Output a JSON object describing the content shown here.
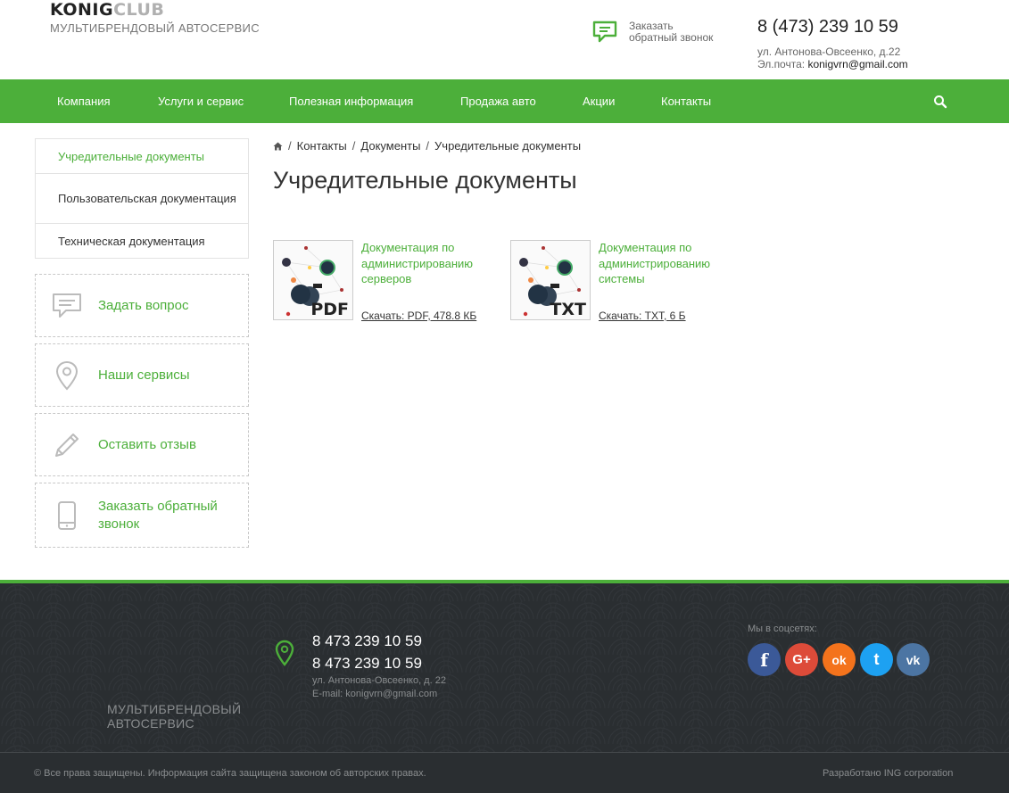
{
  "header": {
    "logo_part1": "KONIG",
    "logo_part2": "CLUB",
    "logo_subtitle": "МУЛЬТИБРЕНДОВЫЙ АВТОСЕРВИС",
    "callback_line1": "Заказать",
    "callback_line2": "обратный звонок",
    "phone": "8 (473) 239 10 59",
    "address": "ул. Антонова-Овсеенко, д.22",
    "email_label": "Эл.почта: ",
    "email": "konigvrn@gmail.com"
  },
  "nav": {
    "items": [
      "Компания",
      "Услуги и сервис",
      "Полезная информация",
      "Продажа авто",
      "Акции",
      "Контакты"
    ],
    "search_icon": "search-icon"
  },
  "sidebar": {
    "menu": [
      "Учредительные документы",
      "Пользовательская документация",
      "Техническая документация"
    ],
    "boxes": [
      {
        "label": "Задать вопрос",
        "icon": "chat-icon"
      },
      {
        "label": "Наши сервисы",
        "icon": "map-pin-icon"
      },
      {
        "label": "Оставить отзыв",
        "icon": "pencil-icon"
      },
      {
        "label": "Заказать обратный звонок",
        "icon": "smartphone-icon"
      }
    ]
  },
  "breadcrumb": {
    "home_icon": "home-icon",
    "items": [
      "Контакты",
      "Документы",
      "Учредительные документы"
    ]
  },
  "page_title": "Учредительные документы",
  "documents": [
    {
      "title": "Документация по администрированию серверов",
      "type": "PDF",
      "download": "Скачать: PDF, 478.8 КБ"
    },
    {
      "title": "Документация по администрированию системы",
      "type": "TXT",
      "download": "Скачать: TXT, 6 Б"
    }
  ],
  "footer": {
    "subtitle": "МУЛЬТИБРЕНДОВЫЙ АВТОСЕРВИС",
    "phone1": "8 473 239 10 59",
    "phone2": "8 473 239 10 59",
    "address": "ул. Антонова-Овсеенко, д. 22",
    "email": "E-mail: konigvrn@gmail.com",
    "social_label": "Мы в соцсетях:",
    "social": [
      {
        "name": "facebook-icon",
        "glyph": "f",
        "color": "#3b5998"
      },
      {
        "name": "google-plus-icon",
        "glyph": "G+",
        "color": "#dd4b39"
      },
      {
        "name": "odnoklassniki-icon",
        "glyph": "ok",
        "color": "#f4731c"
      },
      {
        "name": "twitter-icon",
        "glyph": "t",
        "color": "#1da1f2"
      },
      {
        "name": "vk-icon",
        "glyph": "vk",
        "color": "#4c75a3"
      }
    ],
    "copyright": "© Все права защищены. Информация сайта защищена законом об авторских правах.",
    "developer": "Разработано ING corporation"
  },
  "colors": {
    "accent": "#4caf3a",
    "footer_bg": "#2a2e31"
  }
}
